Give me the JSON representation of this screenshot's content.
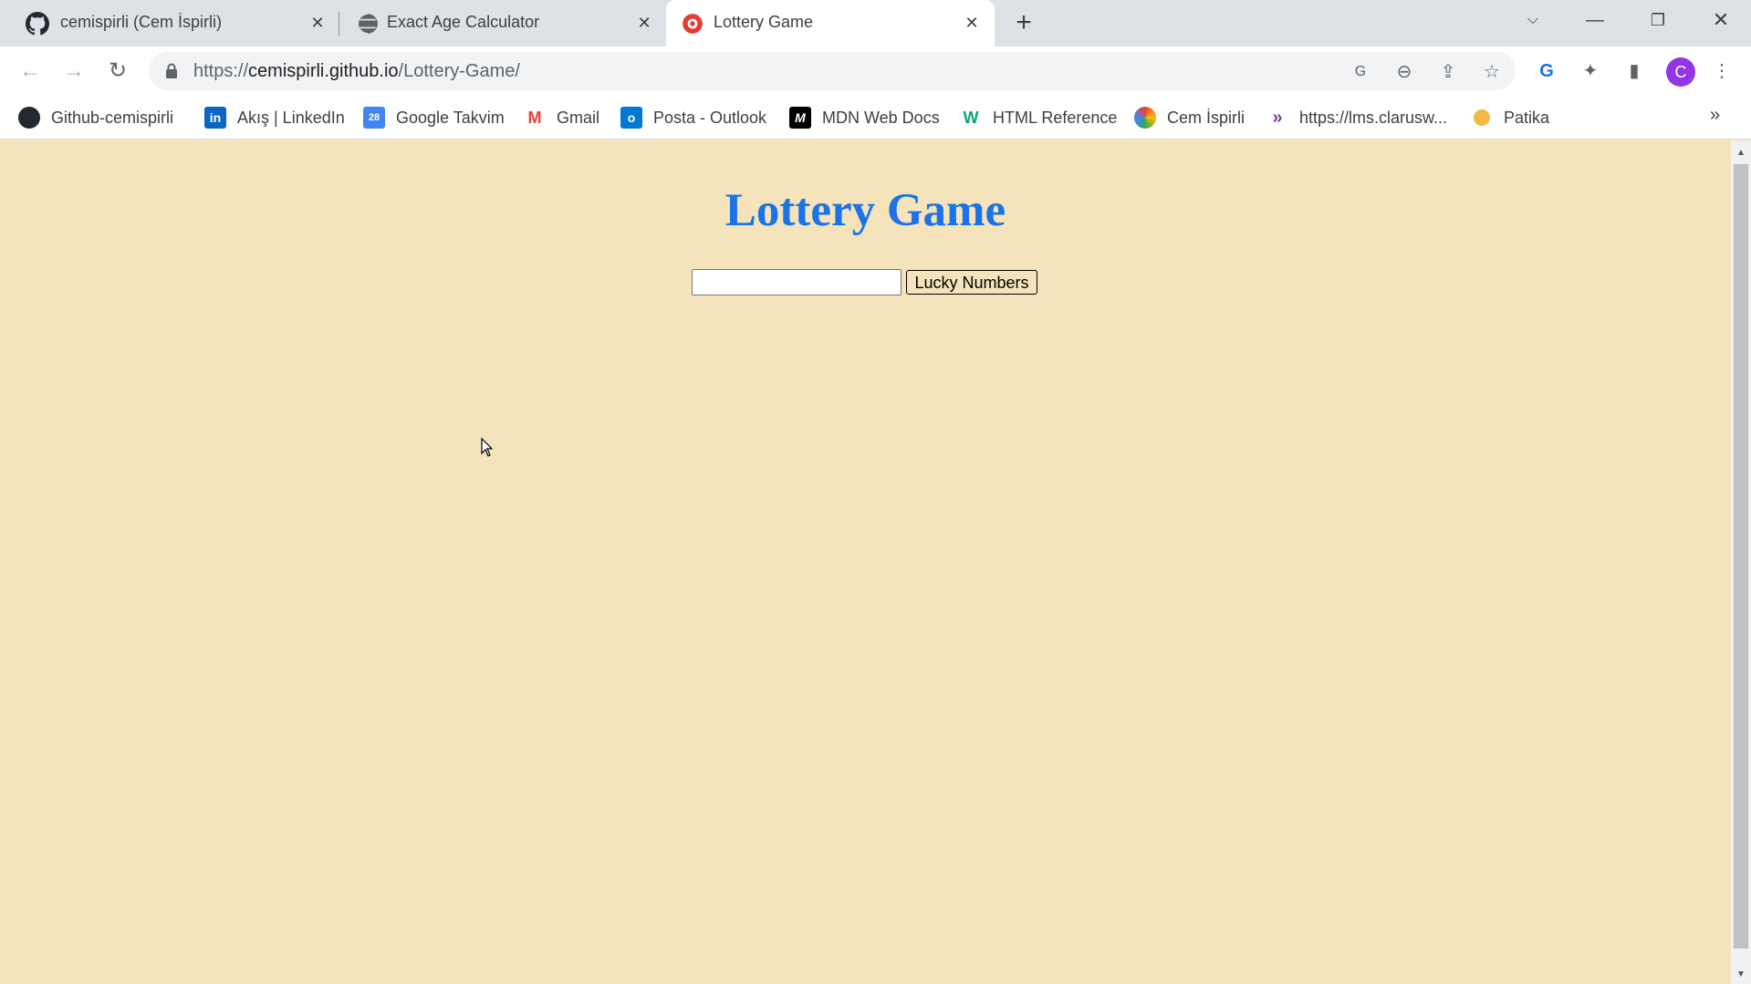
{
  "tabs": [
    {
      "title": "cemispirli (Cem İspirli)",
      "icon": "github-icon",
      "active": false
    },
    {
      "title": "Exact Age Calculator",
      "icon": "globe-icon",
      "active": false
    },
    {
      "title": "Lottery Game",
      "icon": "lottery-favicon-icon",
      "active": true
    }
  ],
  "address": {
    "scheme": "https://",
    "host": "cemispirli.github.io",
    "path": "/Lottery-Game/"
  },
  "profile": {
    "initial": "C"
  },
  "bookmarks": [
    {
      "label": "Github-cemispirli",
      "icon": "github-icon"
    },
    {
      "label": "Akış | LinkedIn",
      "icon": "linkedin-icon"
    },
    {
      "label": "Google Takvim",
      "icon": "google-calendar-icon"
    },
    {
      "label": "Gmail",
      "icon": "gmail-icon"
    },
    {
      "label": "Posta - Outlook",
      "icon": "outlook-icon"
    },
    {
      "label": "MDN Web Docs",
      "icon": "mdn-icon"
    },
    {
      "label": "HTML Reference",
      "icon": "w3-icon"
    },
    {
      "label": "Cem İspirli",
      "icon": "swirl-icon"
    },
    {
      "label": "https://lms.clarusw...",
      "icon": "clarusway-icon"
    },
    {
      "label": "Patika",
      "icon": "patika-icon"
    }
  ],
  "main": {
    "heading": "Lottery Game",
    "input_value": "",
    "button_label": "Lucky Numbers"
  },
  "colors": {
    "page_background": "#f5e4bb",
    "heading": "#1a73e8"
  }
}
